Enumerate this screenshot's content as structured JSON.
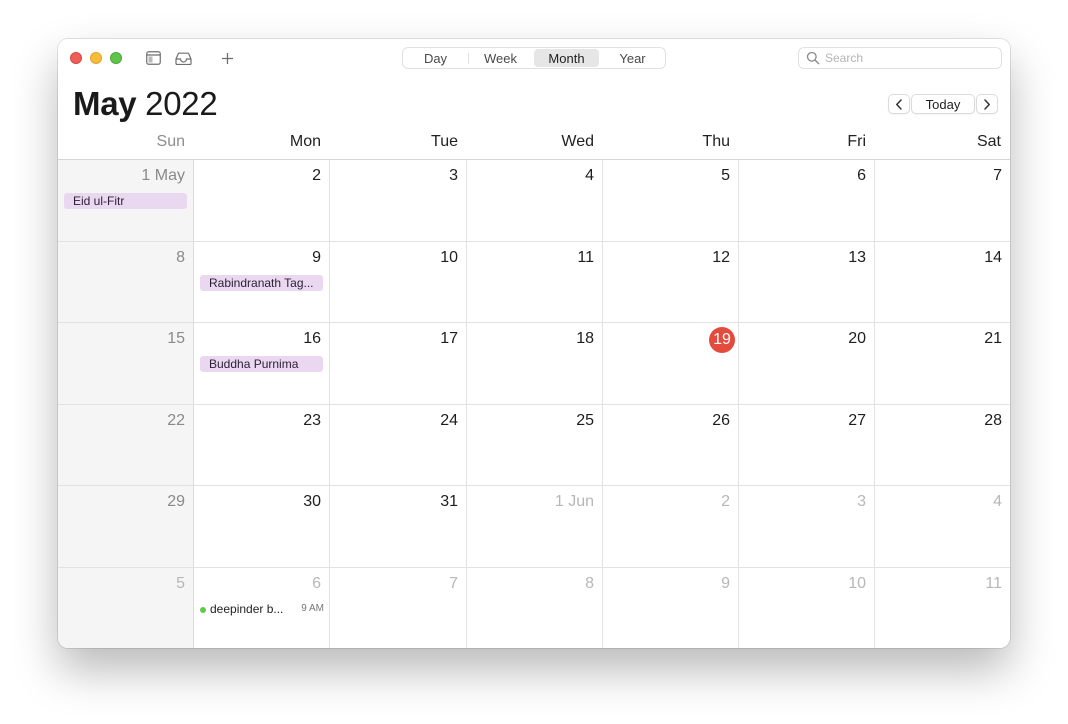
{
  "toolbar": {
    "views": [
      "Day",
      "Week",
      "Month",
      "Year"
    ],
    "active_view": "Month",
    "search_placeholder": "Search",
    "icons": {
      "calendars": "calendar-list-icon",
      "inbox": "inbox-tray-icon",
      "add": "plus-icon",
      "search": "magnifier-icon"
    }
  },
  "header": {
    "month": "May",
    "year": "2022",
    "today_label": "Today"
  },
  "weekdays": [
    "Sun",
    "Mon",
    "Tue",
    "Wed",
    "Thu",
    "Fri",
    "Sat"
  ],
  "weeks": [
    [
      {
        "label": "1 May",
        "events": [
          {
            "title": "Eid ul-Fitr"
          }
        ]
      },
      {
        "label": "2"
      },
      {
        "label": "3"
      },
      {
        "label": "4"
      },
      {
        "label": "5"
      },
      {
        "label": "6"
      },
      {
        "label": "7"
      }
    ],
    [
      {
        "label": "8"
      },
      {
        "label": "9",
        "events": [
          {
            "title": "Rabindranath Tag..."
          }
        ]
      },
      {
        "label": "10"
      },
      {
        "label": "11"
      },
      {
        "label": "12"
      },
      {
        "label": "13"
      },
      {
        "label": "14"
      }
    ],
    [
      {
        "label": "15"
      },
      {
        "label": "16",
        "events": [
          {
            "title": "Buddha Purnima"
          }
        ]
      },
      {
        "label": "17"
      },
      {
        "label": "18"
      },
      {
        "label": "19",
        "today": true
      },
      {
        "label": "20"
      },
      {
        "label": "21"
      }
    ],
    [
      {
        "label": "22"
      },
      {
        "label": "23"
      },
      {
        "label": "24"
      },
      {
        "label": "25"
      },
      {
        "label": "26"
      },
      {
        "label": "27"
      },
      {
        "label": "28"
      }
    ],
    [
      {
        "label": "29"
      },
      {
        "label": "30"
      },
      {
        "label": "31"
      },
      {
        "label": "1 Jun",
        "other": true
      },
      {
        "label": "2",
        "other": true
      },
      {
        "label": "3",
        "other": true
      },
      {
        "label": "4",
        "other": true
      }
    ],
    [
      {
        "label": "5",
        "other": true
      },
      {
        "label": "6",
        "other": true,
        "timed": [
          {
            "title": "deepinder b...",
            "time": "9 AM"
          }
        ]
      },
      {
        "label": "7",
        "other": true
      },
      {
        "label": "8",
        "other": true
      },
      {
        "label": "9",
        "other": true
      },
      {
        "label": "10",
        "other": true
      },
      {
        "label": "11",
        "other": true
      }
    ]
  ],
  "colors": {
    "today_badge": "#e54b3d",
    "holiday_event": "#ead8f1",
    "timed_event_dot": "#60c94c",
    "sunday_column": "#f5f5f5"
  }
}
